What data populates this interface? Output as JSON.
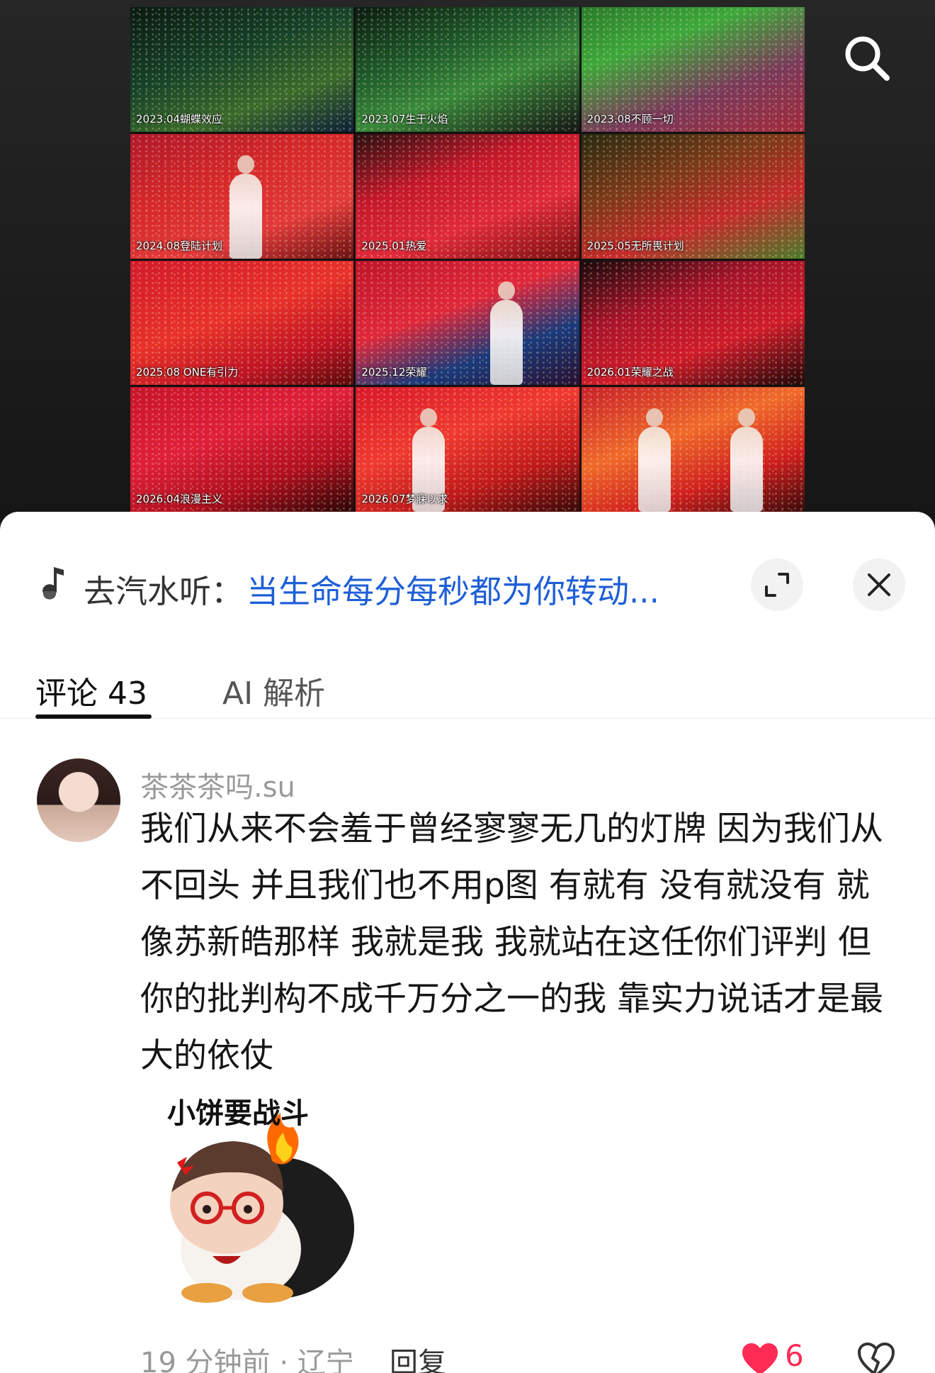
{
  "video": {
    "tiles": [
      {
        "caption": "2023.04蝴蝶效应",
        "bg": "linear-gradient(160deg,#0b1a12 0%,#164228 40%,#3b6b2a 70%,#0d2038 100%)"
      },
      {
        "caption": "2023.07生于火焰",
        "bg": "linear-gradient(160deg,#0c1c10 0%,#1e5a2a 35%,#3a8a3a 60%,#151515 100%)"
      },
      {
        "caption": "2023.08不顾一切",
        "bg": "linear-gradient(160deg,#2a7a2a 0%,#3ea83a 30%,#7a3a5a 65%,#a32a3a 100%)"
      },
      {
        "caption": "2024.08登陆计划",
        "bg": "linear-gradient(160deg,#b0182a 0%,#d72a2a 40%,#e23a3a 70%,#6a1212 100%)"
      },
      {
        "caption": "2025.01热爱",
        "bg": "linear-gradient(160deg,#2a1010 0%,#c4182a 35%,#e02a3a 65%,#7a1010 100%)"
      },
      {
        "caption": "2025.05无所畏计划",
        "bg": "linear-gradient(160deg,#2a2a10 0%,#7a3a18 35%,#c62a2a 65%,#4a7a2a 100%)"
      },
      {
        "caption": "2025.08 ONE有引力",
        "bg": "linear-gradient(160deg,#d21a2a 0%,#e8322a 45%,#c01424 75%,#5a0a0a 100%)"
      },
      {
        "caption": "2025.12荣耀",
        "bg": "linear-gradient(160deg,#c0142a 0%,#e0283a 40%,#1a3a7a 70%,#2a1030 100%)"
      },
      {
        "caption": "2026.01荣耀之战",
        "bg": "linear-gradient(160deg,#1a0a0a 0%,#a8142a 35%,#d01c2a 65%,#200808 100%)"
      },
      {
        "caption": "2026.04浪漫主义",
        "bg": "linear-gradient(160deg,#c8142a 0%,#e0203a 40%,#b0101e 70%,#2a0606 100%)"
      },
      {
        "caption": "2026.07梦寐以求",
        "bg": "linear-gradient(160deg,#d8182a 0%,#f03a30 40%,#c01a1a 70%,#3a0808 100%)"
      },
      {
        "caption": "",
        "bg": "linear-gradient(160deg,#c8202a 0%,#f06a2a 40%,#d0201e 70%,#3a0a0a 100%)"
      }
    ]
  },
  "icons": {
    "search": "search-icon",
    "music": "music-note-icon",
    "expand": "expand-icon",
    "close": "close-icon",
    "like": "heart-icon",
    "dislike": "broken-heart-icon"
  },
  "music_bar": {
    "prefix": "去汽水听：",
    "title": "当生命每分每秒都为你转动..."
  },
  "tabs": {
    "comments": "评论 43",
    "ai": "AI 解析"
  },
  "comment": {
    "username": "茶茶茶吗.su",
    "text": "我们从来不会羞于曾经寥寥无几的灯牌 因为我们从不回头 并且我们也不用p图 有就有 没有就没有 就像苏新皓那样 我就是我 我就站在这任你们评判 但你的批判构不成千万分之一的我 靠实力说话才是最大的依仗",
    "sticker_label": "小饼要战斗",
    "time_location": "19 分钟前 · 辽宁",
    "reply": "回复",
    "likes": "6"
  },
  "colors": {
    "accent_blue": "#1e5fd8",
    "like_red": "#fe2c55",
    "background_dark": "#1b1b1b"
  }
}
